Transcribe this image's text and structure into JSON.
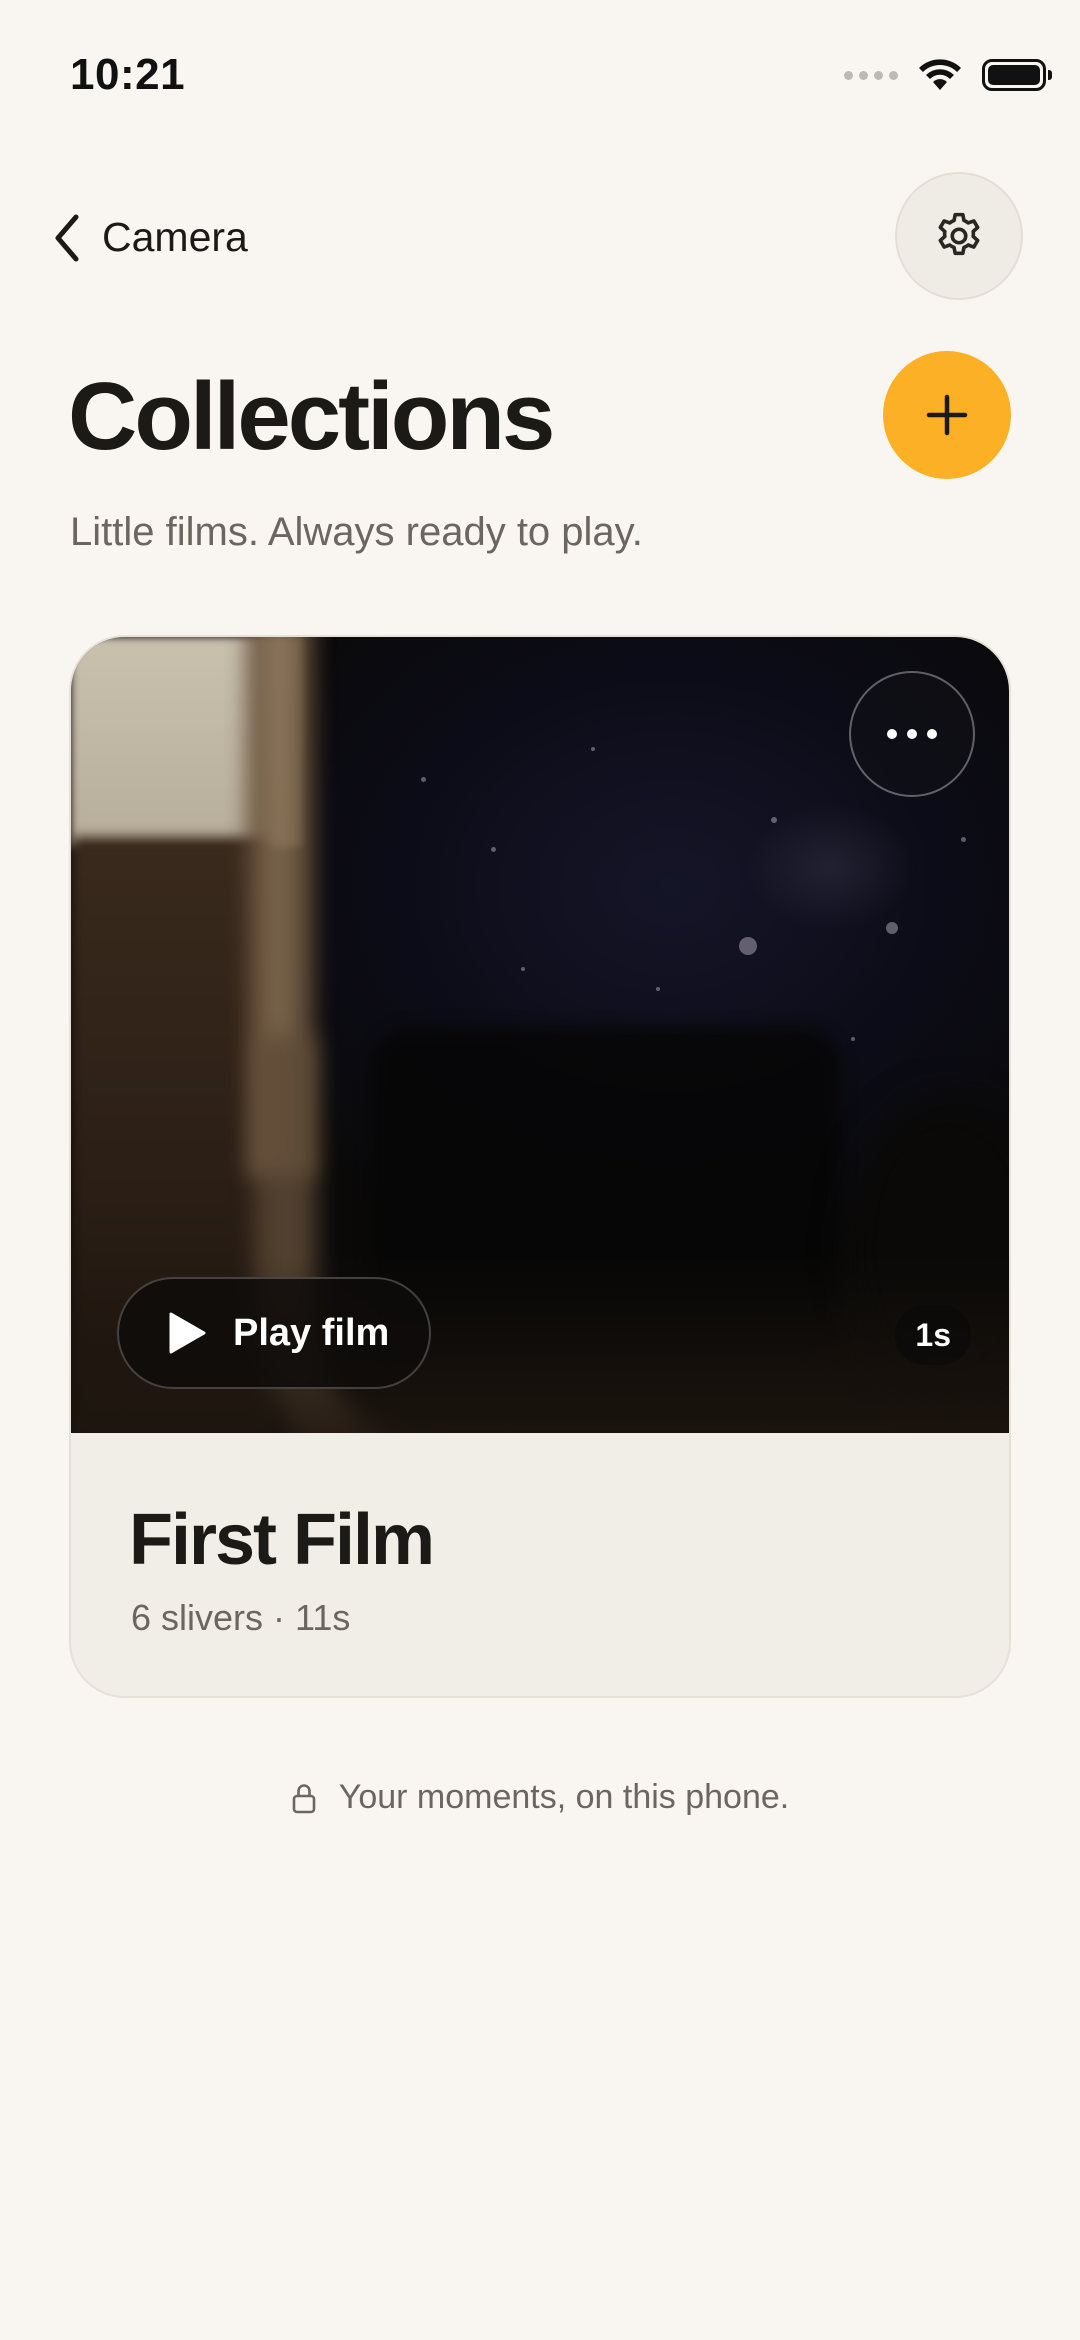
{
  "status_bar": {
    "time": "10:21",
    "icons": [
      "signal-icon",
      "wifi-icon",
      "battery-icon"
    ]
  },
  "nav": {
    "back_label": "Camera",
    "back_icon": "chevron-left-icon",
    "settings_icon": "gear-icon"
  },
  "header": {
    "title": "Collections",
    "subtitle": "Little films. Always ready to play.",
    "add_icon": "plus-icon"
  },
  "colors": {
    "background": "#f9f6f2",
    "accent": "#fbb026",
    "card": "#f1ede7",
    "text_primary": "#1c1a17",
    "text_secondary": "#6b665f"
  },
  "film_card": {
    "more_icon": "more-horizontal-icon",
    "play_label": "Play film",
    "play_icon": "play-icon",
    "clip_duration": "1s",
    "title": "First Film",
    "meta": "6 slivers · 11s"
  },
  "footer": {
    "note": "Your moments, on this phone.",
    "icon": "lock-icon"
  }
}
